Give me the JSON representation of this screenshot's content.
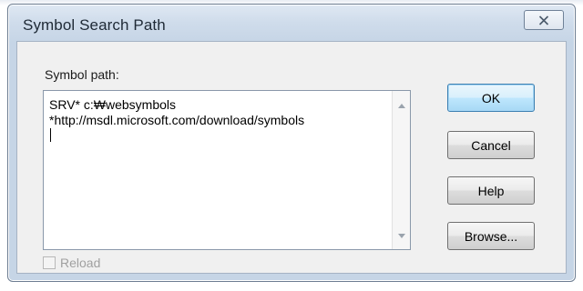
{
  "dialog": {
    "title": "Symbol Search Path",
    "close_icon": "close-x-icon"
  },
  "form": {
    "path_label": "Symbol path:",
    "path_value": "SRV* c:₩websymbols\n*http://msdl.microsoft.com/download/symbols\n"
  },
  "buttons": {
    "ok": "OK",
    "cancel": "Cancel",
    "help": "Help",
    "browse": "Browse..."
  },
  "reload": {
    "label": "Reload",
    "checked": false,
    "enabled": false
  },
  "colors": {
    "default_button_border": "#3c7fb1",
    "title_bar": "#cfdceb"
  }
}
